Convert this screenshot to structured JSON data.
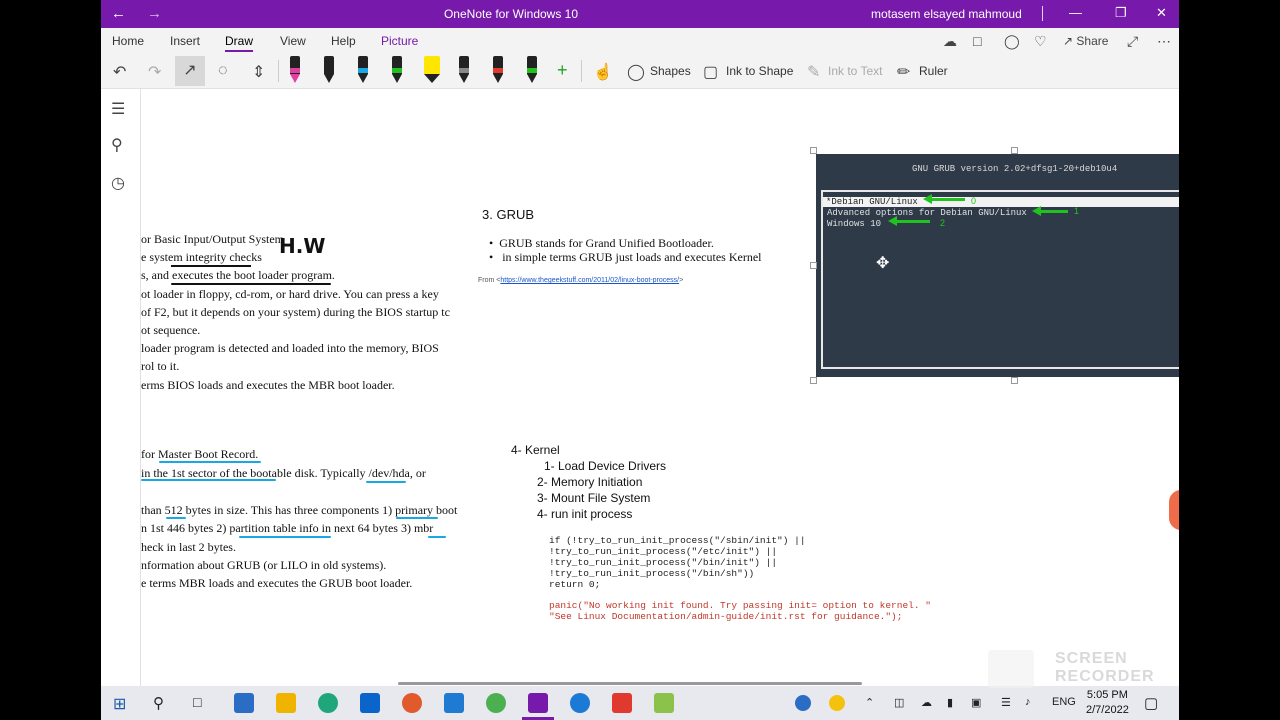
{
  "window": {
    "title": "OneNote for Windows 10",
    "user": "motasem elsayed mahmoud",
    "back_icon": "←",
    "forward_icon": "→"
  },
  "ribbon": {
    "tabs": [
      "Home",
      "Insert",
      "Draw",
      "View",
      "Help",
      "Picture"
    ],
    "active_tab": "Draw",
    "share_label": "Share"
  },
  "toolbar": {
    "shapes_label": "Shapes",
    "ink_to_shape_label": "Ink to Shape",
    "ink_to_text_label": "Ink to Text",
    "ruler_label": "Ruler",
    "pen_colors": [
      "#e040a0",
      "#222222",
      "#1aa7e6",
      "#21c21f",
      "#ffe600",
      "#222222",
      "#e23b2e",
      "#222222"
    ]
  },
  "notes": {
    "bios_lines": [
      "or Basic Input/Output System",
      "e system integrity checks",
      "s, and executes the boot loader program.",
      "ot loader in floppy, cd-rom, or hard drive. You can press a key",
      "of F2, but it depends on your system) during the BIOS startup tc",
      "ot sequence.",
      "loader program is detected and loaded into the memory, BIOS",
      "rol to it.",
      "erms BIOS loads and executes the MBR boot loader."
    ],
    "handwriting": "H.W",
    "mbr_lines": [
      "for Master Boot Record.",
      "in the 1st sector of the bootable disk. Typically /dev/hda, or",
      "than 512 bytes in size. This has three components 1) primary boot",
      "n 1st 446 bytes 2) partition table info in next 64 bytes 3) mbr",
      "heck in last 2 bytes.",
      "nformation about GRUB (or LILO in old systems).",
      "e terms MBR loads and executes the GRUB boot loader."
    ],
    "grub_heading": "3.  GRUB",
    "grub_bullets": [
      "GRUB stands for Grand Unified Bootloader.",
      " in simple terms GRUB just loads and executes Kernel"
    ],
    "from_label": "From <",
    "from_link": "https://www.thegeekstuff.com/2011/02/linux-boot-process/",
    "from_end": ">",
    "kernel_heading": "4- Kernel",
    "kernel_items": [
      "1- Load Device Drivers",
      "2- Memory Initiation",
      "3- Mount File System",
      "4- run init process"
    ],
    "code_lines": [
      "if (!try_to_run_init_process(\"/sbin/init\") ||",
      "    !try_to_run_init_process(\"/etc/init\") ||",
      "    !try_to_run_init_process(\"/bin/init\") ||",
      "    !try_to_run_init_process(\"/bin/sh\"))",
      "        return 0;",
      "panic(\"No working init found.  Try passing init= option to kernel. \"",
      "      \"See Linux Documentation/admin-guide/init.rst for guidance.\");"
    ]
  },
  "grub_screen": {
    "header": "GNU GRUB  version 2.02+dfsg1-20+deb10u4",
    "entries": [
      "*Debian GNU/Linux",
      " Advanced options for Debian GNU/Linux",
      " Windows 10"
    ],
    "labels": [
      "0",
      "1",
      "2"
    ]
  },
  "taskbar": {
    "language": "ENG",
    "time": "5:05 PM",
    "date": "2/7/2022"
  },
  "watermark": "SCREEN\nRECORDER"
}
